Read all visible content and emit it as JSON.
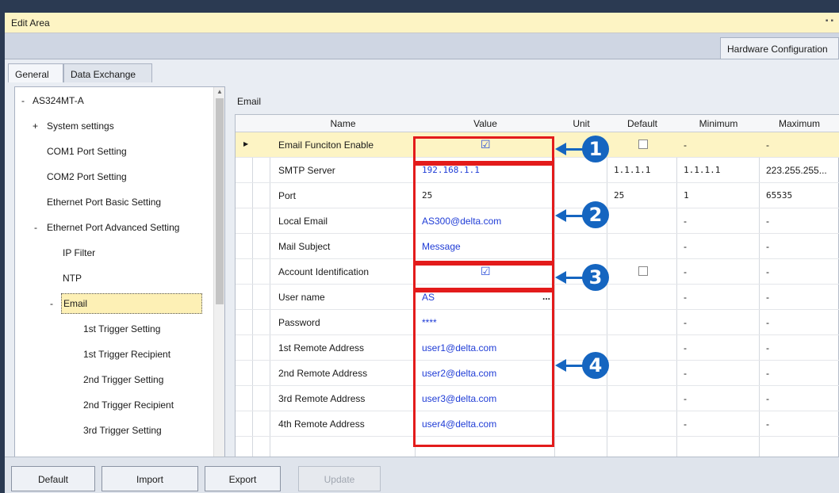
{
  "window": {
    "title": "Edit Area"
  },
  "top_tab": "Hardware Configuration",
  "sub_tabs": [
    "General",
    "Data Exchange"
  ],
  "tree": {
    "items": [
      {
        "exp": "-",
        "label": "AS324MT-A"
      },
      {
        "exp": "+",
        "label": "System settings"
      },
      {
        "exp": "",
        "label": "COM1 Port Setting"
      },
      {
        "exp": "",
        "label": "COM2 Port Setting"
      },
      {
        "exp": "",
        "label": "Ethernet Port Basic Setting"
      },
      {
        "exp": "-",
        "label": "Ethernet Port Advanced Setting"
      },
      {
        "exp": "",
        "label": "IP Filter"
      },
      {
        "exp": "",
        "label": "NTP"
      },
      {
        "exp": "-",
        "label": "Email"
      },
      {
        "exp": "",
        "label": "1st Trigger Setting"
      },
      {
        "exp": "",
        "label": "1st Trigger Recipient"
      },
      {
        "exp": "",
        "label": "2nd Trigger Setting"
      },
      {
        "exp": "",
        "label": "2nd Trigger Recipient"
      },
      {
        "exp": "",
        "label": "3rd Trigger Setting"
      }
    ]
  },
  "section_label": "Email",
  "grid": {
    "headers": [
      "Name",
      "Value",
      "Unit",
      "Default",
      "Minimum",
      "Maximum"
    ],
    "rows": [
      {
        "name": "Email Funciton Enable",
        "value": "",
        "checkbox": true,
        "unit": "",
        "default": "",
        "default_checkbox": true,
        "minimum": "-",
        "maximum": "-"
      },
      {
        "name": "SMTP Server",
        "value": "192.168.1.1",
        "unit": "",
        "default": "1.1.1.1",
        "minimum": "1.1.1.1",
        "maximum": "223.255.255..."
      },
      {
        "name": "Port",
        "value": "25",
        "unit": "",
        "default": "25",
        "minimum": "1",
        "maximum": "65535"
      },
      {
        "name": "Local Email",
        "value": "AS300@delta.com",
        "unit": "",
        "default": "",
        "minimum": "-",
        "maximum": "-"
      },
      {
        "name": "Mail Subject",
        "value": "Message",
        "unit": "",
        "default": "",
        "minimum": "-",
        "maximum": "-"
      },
      {
        "name": "Account Identification",
        "value": "",
        "checkbox": true,
        "unit": "",
        "default": "",
        "default_checkbox": true,
        "minimum": "-",
        "maximum": "-"
      },
      {
        "name": "User name",
        "value": "AS",
        "unit": "",
        "default": "",
        "minimum": "-",
        "maximum": "-",
        "ellipsis": "..."
      },
      {
        "name": "Password",
        "value": "****",
        "unit": "",
        "default": "",
        "minimum": "-",
        "maximum": "-"
      },
      {
        "name": "1st Remote Address",
        "value": "user1@delta.com",
        "unit": "",
        "default": "",
        "minimum": "-",
        "maximum": "-"
      },
      {
        "name": "2nd Remote Address",
        "value": "user2@delta.com",
        "unit": "",
        "default": "",
        "minimum": "-",
        "maximum": "-"
      },
      {
        "name": "3rd Remote Address",
        "value": "user3@delta.com",
        "unit": "",
        "default": "",
        "minimum": "-",
        "maximum": "-"
      },
      {
        "name": "4th Remote Address",
        "value": "user4@delta.com",
        "unit": "",
        "default": "",
        "minimum": "-",
        "maximum": "-"
      }
    ]
  },
  "callouts": [
    "1",
    "2",
    "3",
    "4"
  ],
  "buttons": {
    "default": "Default",
    "import": "Import",
    "export": "Export",
    "update": "Update"
  },
  "colors": {
    "accent_red": "#e31b1b",
    "callout_blue": "#1565c0",
    "value_blue": "#1f3cd6",
    "title_bar": "#fdf4c4"
  },
  "icons": {
    "check": "checkmark-icon",
    "row_selector": "triangle-right-icon",
    "ellipsis": "ellipsis-icon"
  }
}
